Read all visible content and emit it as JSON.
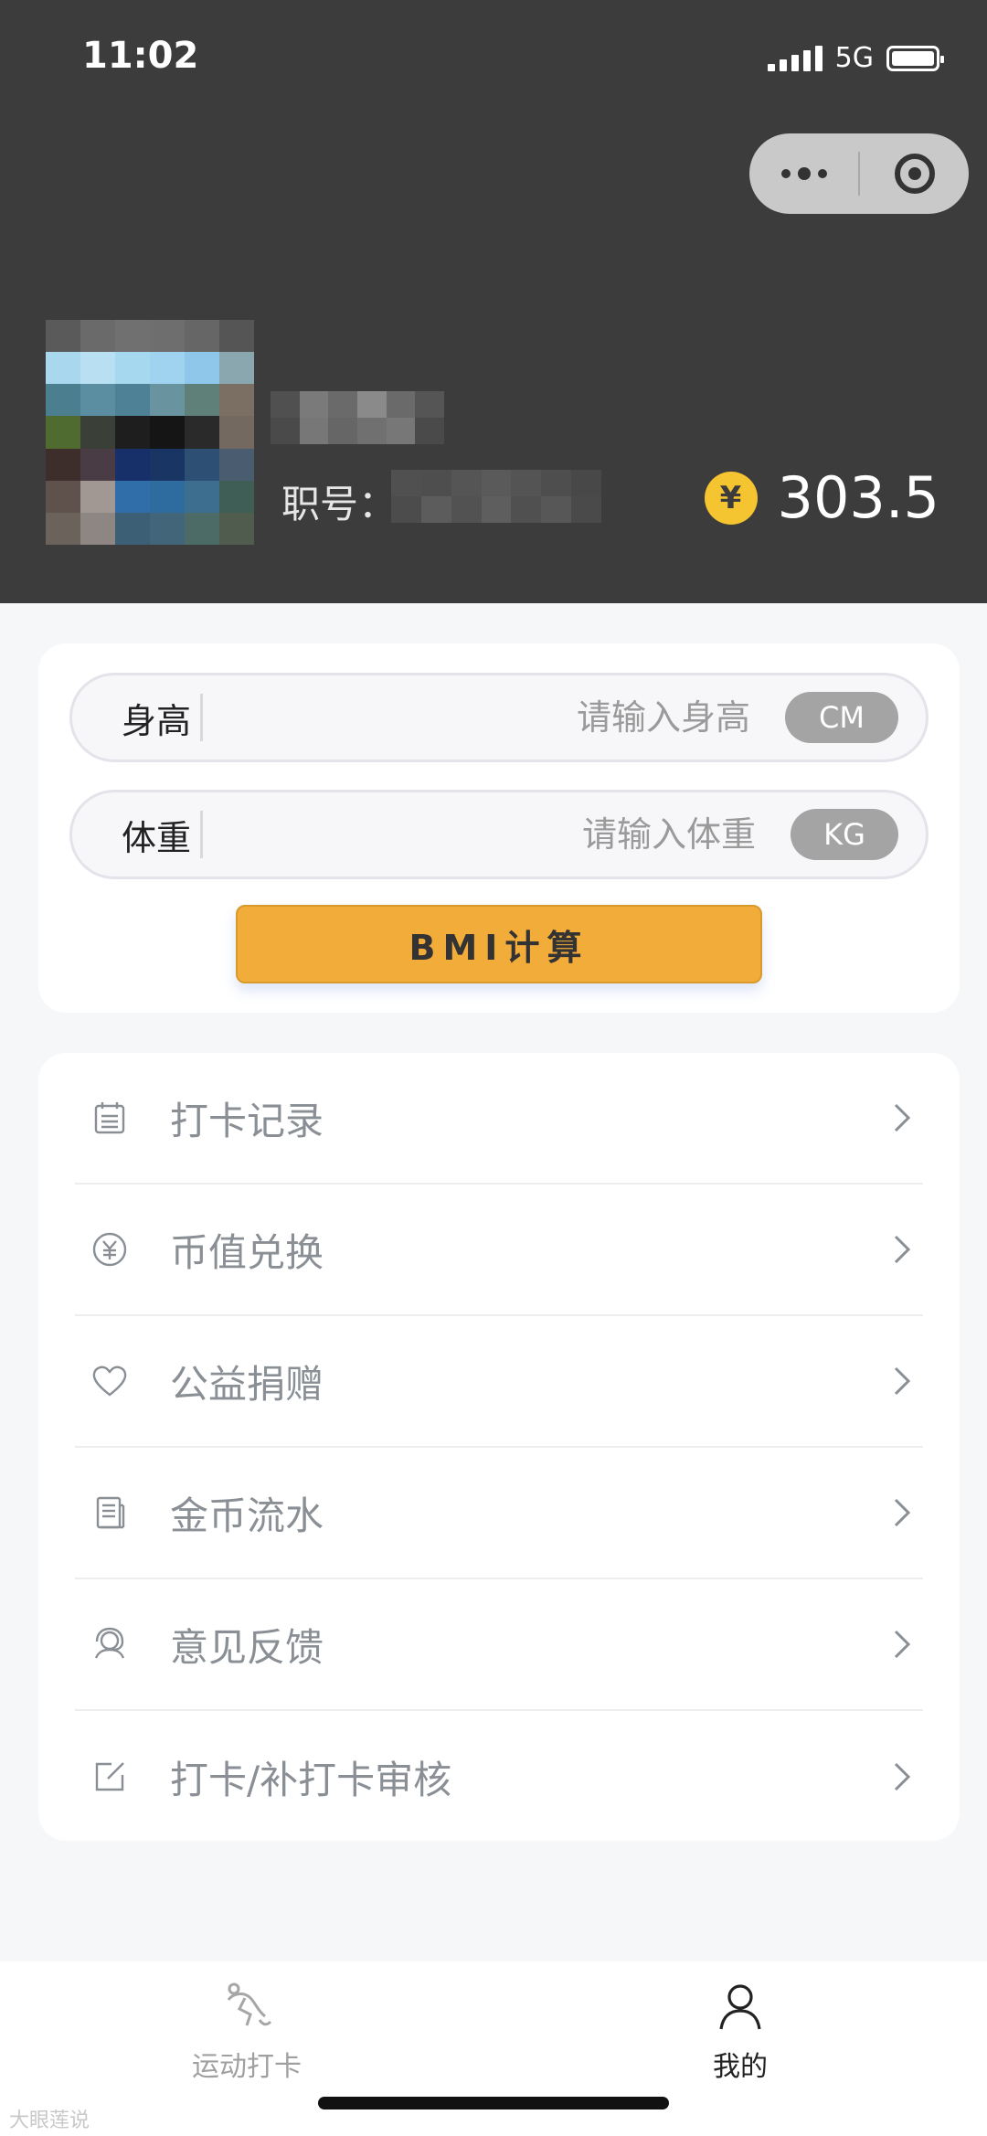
{
  "status_bar": {
    "time": "11:02",
    "network": "5G"
  },
  "profile": {
    "employee_label": "职号：",
    "coins": "303.5",
    "coin_symbol": "¥"
  },
  "bmi": {
    "height_label": "身高",
    "height_placeholder": "请输入身高",
    "height_unit": "CM",
    "weight_label": "体重",
    "weight_placeholder": "请输入体重",
    "weight_unit": "KG",
    "button": "BMI计算"
  },
  "menu": {
    "items": [
      {
        "label": "打卡记录",
        "icon": "calendar-icon"
      },
      {
        "label": "币值兑换",
        "icon": "yuan-circle-icon"
      },
      {
        "label": "公益捐赠",
        "icon": "heart-icon"
      },
      {
        "label": "金币流水",
        "icon": "document-icon"
      },
      {
        "label": "意见反馈",
        "icon": "support-agent-icon"
      },
      {
        "label": "打卡/补打卡审核",
        "icon": "edit-icon"
      }
    ]
  },
  "tabbar": {
    "tabs": [
      {
        "label": "运动打卡",
        "icon": "run-icon",
        "active": false
      },
      {
        "label": "我的",
        "icon": "person-icon",
        "active": true
      }
    ]
  },
  "watermark": "大眼莲说"
}
